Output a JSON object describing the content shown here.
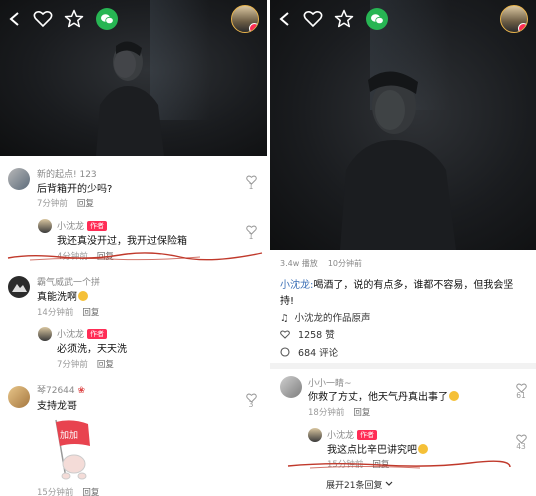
{
  "left": {
    "comments": [
      {
        "name": "新的起点!",
        "text": "后背箱开的少吗?",
        "time": "7分钟前",
        "reply": "回复",
        "likes": "1",
        "num": "123"
      },
      {
        "name": "小沈龙",
        "tag": "作者",
        "text": "我还真没开过，我开过保险箱",
        "time": "4分钟前",
        "reply": "回复",
        "likes": "1"
      },
      {
        "name": "霸气威武一个拼",
        "text": "真能洗啊",
        "time": "14分钟前",
        "reply": "回复"
      },
      {
        "name": "小沈龙",
        "tag": "作者",
        "text": "必须洗，天天洗",
        "time": "7分钟前",
        "reply": "回复"
      },
      {
        "name": "琴72644",
        "text": "支持龙哥",
        "time": "15分钟前",
        "reply": "回复",
        "likes": "3"
      }
    ],
    "sticker_text": "加加"
  },
  "right": {
    "stats": {
      "plays": "3.4w 播放",
      "time": "10分钟前"
    },
    "caption": {
      "author": "小沈龙:",
      "line1": "喝酒了，说的有点多，谁都不容易，但我会坚",
      "line2": "持!"
    },
    "music": "小沈龙的作品原声",
    "likes": "1258 赞",
    "comments_count": "684 评论",
    "comments": [
      {
        "name": "小小一睛~",
        "text": "你救了方丈，他天气丹真出事了",
        "time": "18分钟前",
        "reply": "回复",
        "likes": "61"
      },
      {
        "name": "小沈龙",
        "tag": "作者",
        "text": "我这点比辛巴讲究吧",
        "time": "15分钟前",
        "reply": "回复",
        "likes": "43"
      }
    ],
    "expand": "展开21条回复"
  },
  "colors": {
    "accent": "#ff2c55",
    "wechat": "#27b553",
    "annotation": "#c0392b"
  },
  "icons": [
    "back-icon",
    "heart-icon",
    "star-icon",
    "wechat-icon",
    "like-icon",
    "music-icon",
    "comment-icon",
    "chevron-down-icon"
  ]
}
